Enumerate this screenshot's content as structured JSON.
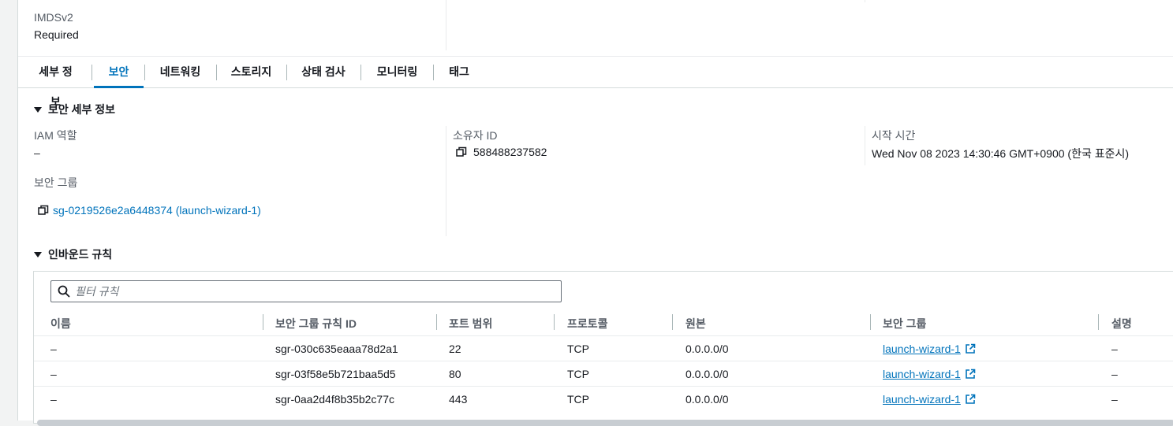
{
  "top": {
    "imds_label": "IMDSv2",
    "imds_value": "Required"
  },
  "tabs": [
    {
      "label": "세부 정보",
      "active": false
    },
    {
      "label": "보안",
      "active": true
    },
    {
      "label": "네트워킹",
      "active": false
    },
    {
      "label": "스토리지",
      "active": false
    },
    {
      "label": "상태 검사",
      "active": false
    },
    {
      "label": "모니터링",
      "active": false
    },
    {
      "label": "태그",
      "active": false
    }
  ],
  "security_details": {
    "title": "보안 세부 정보",
    "iam_role_label": "IAM 역할",
    "iam_role_value": "–",
    "owner_id_label": "소유자 ID",
    "owner_id_value": "588488237582",
    "launch_time_label": "시작 시간",
    "launch_time_value": "Wed Nov 08 2023 14:30:46 GMT+0900 (한국 표준시)",
    "security_group_label": "보안 그룹",
    "security_group_value": "sg-0219526e2a6448374 (launch-wizard-1)"
  },
  "inbound": {
    "title": "인바운드 규칙",
    "filter_placeholder": "필터 규칙",
    "columns": [
      "이름",
      "보안 그룹 규칙 ID",
      "포트 범위",
      "프로토콜",
      "원본",
      "보안 그룹",
      "설명"
    ],
    "rows": [
      {
        "name": "–",
        "rule_id": "sgr-030c635eaaa78d2a1",
        "port": "22",
        "protocol": "TCP",
        "source": "0.0.0.0/0",
        "group": "launch-wizard-1",
        "desc": "–"
      },
      {
        "name": "–",
        "rule_id": "sgr-03f58e5b721baa5d5",
        "port": "80",
        "protocol": "TCP",
        "source": "0.0.0.0/0",
        "group": "launch-wizard-1",
        "desc": "–"
      },
      {
        "name": "–",
        "rule_id": "sgr-0aa2d4f8b35b2c77c",
        "port": "443",
        "protocol": "TCP",
        "source": "0.0.0.0/0",
        "group": "launch-wizard-1",
        "desc": "–"
      }
    ]
  },
  "colors": {
    "link": "#0073bb",
    "text": "#16191f",
    "muted": "#545b64"
  }
}
